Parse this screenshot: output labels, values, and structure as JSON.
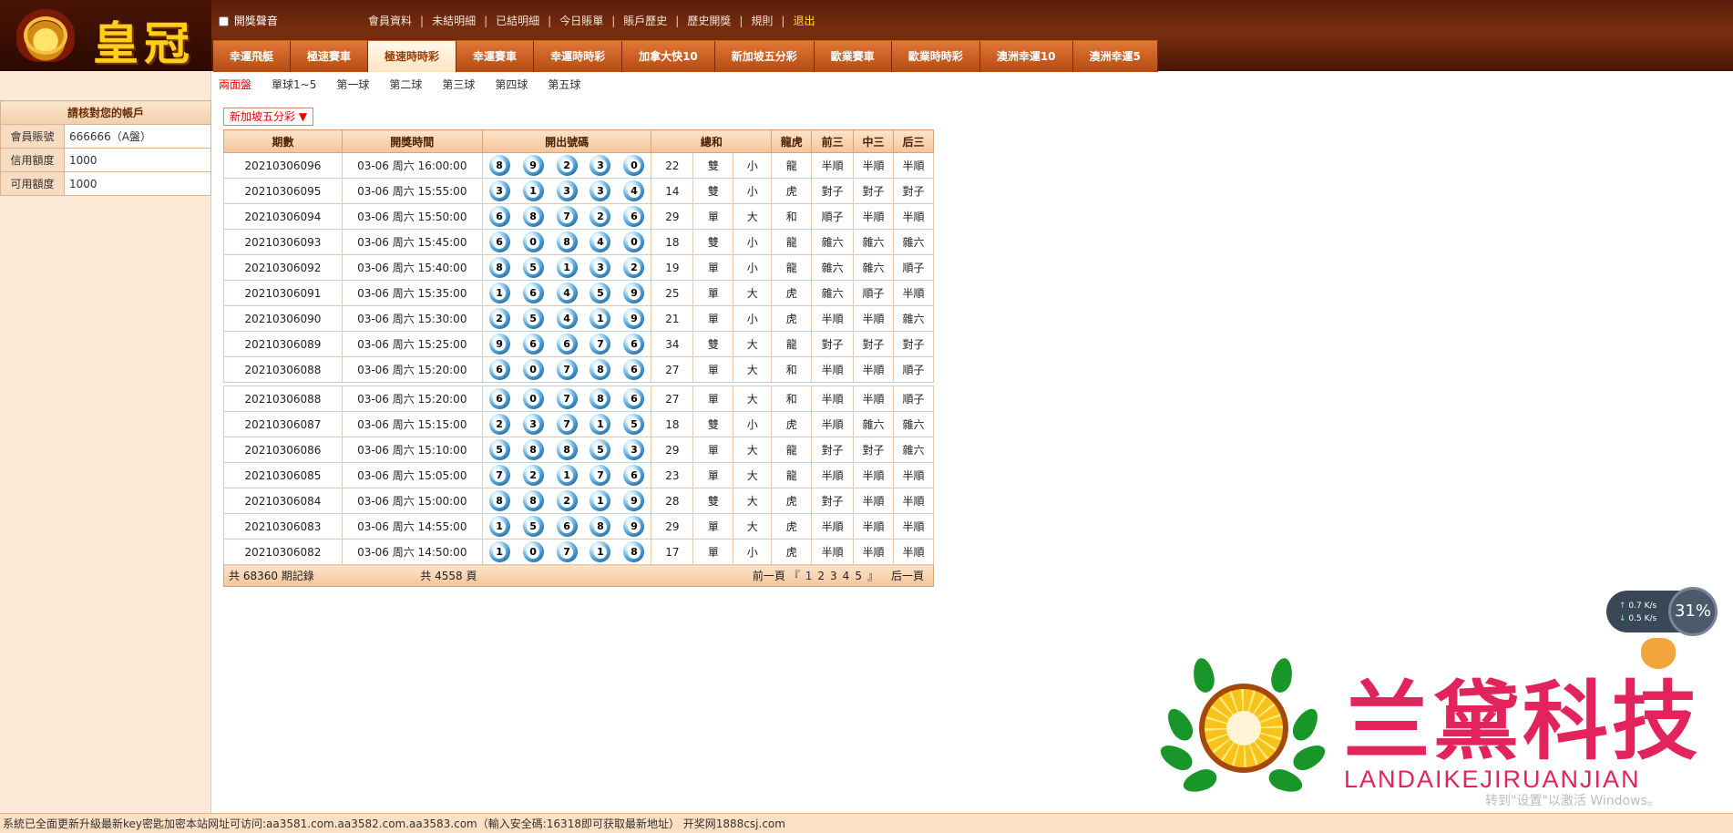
{
  "brand": {
    "name": "皇冠"
  },
  "header": {
    "sound_label": "開獎聲音",
    "links": [
      "會員資料",
      "未結明細",
      "已結明細",
      "今日賬單",
      "賬戶歷史",
      "歷史開獎",
      "規則"
    ],
    "logout": "退出"
  },
  "games": [
    "幸運飛艇",
    "極速賽車",
    "極速時時彩",
    "幸運賽車",
    "幸運時時彩",
    "加拿大快10",
    "新加坡五分彩",
    "歐業賽車",
    "歐業時時彩",
    "澳洲幸運10",
    "澳洲幸運5"
  ],
  "active_game_index": 2,
  "subtabs": [
    "兩面盤",
    "單球1~5",
    "第一球",
    "第二球",
    "第三球",
    "第四球",
    "第五球"
  ],
  "account": {
    "title": "請核對您的帳戶",
    "rows": [
      {
        "label": "會員賬號",
        "value": "666666（A盤）"
      },
      {
        "label": "信用額度",
        "value": "1000"
      },
      {
        "label": "可用額度",
        "value": "1000"
      }
    ]
  },
  "lottery_select": "新加坡五分彩",
  "table": {
    "headers": {
      "issue": "期數",
      "time": "開獎時間",
      "balls": "開出號碼",
      "sum": "總和",
      "dragon": "龍虎",
      "front": "前三",
      "mid": "中三",
      "back": "后三"
    },
    "rows": [
      {
        "issue": "20210306096",
        "date": "03-06",
        "weekday": "周六",
        "time": "16:00:00",
        "balls": [
          "8",
          "9",
          "2",
          "3",
          "0"
        ],
        "sum": "22",
        "oe": "雙",
        "bs": "小",
        "lh": "龍",
        "f": "半順",
        "m": "半順",
        "b": "半順"
      },
      {
        "issue": "20210306095",
        "date": "03-06",
        "weekday": "周六",
        "time": "15:55:00",
        "balls": [
          "3",
          "1",
          "3",
          "3",
          "4"
        ],
        "sum": "14",
        "oe": "雙",
        "bs": "小",
        "lh": "虎",
        "f": "對子",
        "m": "對子",
        "b": "對子"
      },
      {
        "issue": "20210306094",
        "date": "03-06",
        "weekday": "周六",
        "time": "15:50:00",
        "balls": [
          "6",
          "8",
          "7",
          "2",
          "6"
        ],
        "sum": "29",
        "oe": "單",
        "bs": "大",
        "lh": "和",
        "f": "順子",
        "m": "半順",
        "b": "半順"
      },
      {
        "issue": "20210306093",
        "date": "03-06",
        "weekday": "周六",
        "time": "15:45:00",
        "balls": [
          "6",
          "0",
          "8",
          "4",
          "0"
        ],
        "sum": "18",
        "oe": "雙",
        "bs": "小",
        "lh": "龍",
        "f": "雜六",
        "m": "雜六",
        "b": "雜六"
      },
      {
        "issue": "20210306092",
        "date": "03-06",
        "weekday": "周六",
        "time": "15:40:00",
        "balls": [
          "8",
          "5",
          "1",
          "3",
          "2"
        ],
        "sum": "19",
        "oe": "單",
        "bs": "小",
        "lh": "龍",
        "f": "雜六",
        "m": "雜六",
        "b": "順子"
      },
      {
        "issue": "20210306091",
        "date": "03-06",
        "weekday": "周六",
        "time": "15:35:00",
        "balls": [
          "1",
          "6",
          "4",
          "5",
          "9"
        ],
        "sum": "25",
        "oe": "單",
        "bs": "大",
        "lh": "虎",
        "f": "雜六",
        "m": "順子",
        "b": "半順"
      },
      {
        "issue": "20210306090",
        "date": "03-06",
        "weekday": "周六",
        "time": "15:30:00",
        "balls": [
          "2",
          "5",
          "4",
          "1",
          "9"
        ],
        "sum": "21",
        "oe": "單",
        "bs": "小",
        "lh": "虎",
        "f": "半順",
        "m": "半順",
        "b": "雜六"
      },
      {
        "issue": "20210306089",
        "date": "03-06",
        "weekday": "周六",
        "time": "15:25:00",
        "balls": [
          "9",
          "6",
          "6",
          "7",
          "6"
        ],
        "sum": "34",
        "oe": "雙",
        "bs": "大",
        "lh": "龍",
        "f": "對子",
        "m": "對子",
        "b": "對子"
      },
      {
        "issue": "20210306088",
        "date": "03-06",
        "weekday": "周六",
        "time": "15:20:00",
        "balls": [
          "6",
          "0",
          "7",
          "8",
          "6"
        ],
        "sum": "27",
        "oe": "單",
        "bs": "大",
        "lh": "和",
        "f": "半順",
        "m": "半順",
        "b": "順子"
      },
      {
        "issue": "20210306088",
        "date": "03-06",
        "weekday": "周六",
        "time": "15:20:00",
        "balls": [
          "6",
          "0",
          "7",
          "8",
          "6"
        ],
        "sum": "27",
        "oe": "單",
        "bs": "大",
        "lh": "和",
        "f": "半順",
        "m": "半順",
        "b": "順子"
      },
      {
        "issue": "20210306087",
        "date": "03-06",
        "weekday": "周六",
        "time": "15:15:00",
        "balls": [
          "2",
          "3",
          "7",
          "1",
          "5"
        ],
        "sum": "18",
        "oe": "雙",
        "bs": "小",
        "lh": "虎",
        "f": "半順",
        "m": "雜六",
        "b": "雜六"
      },
      {
        "issue": "20210306086",
        "date": "03-06",
        "weekday": "周六",
        "time": "15:10:00",
        "balls": [
          "5",
          "8",
          "8",
          "5",
          "3"
        ],
        "sum": "29",
        "oe": "單",
        "bs": "大",
        "lh": "龍",
        "f": "對子",
        "m": "對子",
        "b": "雜六"
      },
      {
        "issue": "20210306085",
        "date": "03-06",
        "weekday": "周六",
        "time": "15:05:00",
        "balls": [
          "7",
          "2",
          "1",
          "7",
          "6"
        ],
        "sum": "23",
        "oe": "單",
        "bs": "大",
        "lh": "龍",
        "f": "半順",
        "m": "半順",
        "b": "半順"
      },
      {
        "issue": "20210306084",
        "date": "03-06",
        "weekday": "周六",
        "time": "15:00:00",
        "balls": [
          "8",
          "8",
          "2",
          "1",
          "9"
        ],
        "sum": "28",
        "oe": "雙",
        "bs": "大",
        "lh": "虎",
        "f": "對子",
        "m": "半順",
        "b": "半順"
      },
      {
        "issue": "20210306083",
        "date": "03-06",
        "weekday": "周六",
        "time": "14:55:00",
        "balls": [
          "1",
          "5",
          "6",
          "8",
          "9"
        ],
        "sum": "29",
        "oe": "單",
        "bs": "大",
        "lh": "虎",
        "f": "半順",
        "m": "半順",
        "b": "半順"
      },
      {
        "issue": "20210306082",
        "date": "03-06",
        "weekday": "周六",
        "time": "14:50:00",
        "balls": [
          "1",
          "0",
          "7",
          "1",
          "8"
        ],
        "sum": "17",
        "oe": "單",
        "bs": "小",
        "lh": "虎",
        "f": "半順",
        "m": "半順",
        "b": "半順"
      }
    ],
    "footer": {
      "records": "共 68360 期記錄",
      "pages": "共 4558 頁",
      "prev": "前一頁",
      "page_numbers": [
        "1",
        "2",
        "3",
        "4",
        "5"
      ],
      "next": "后一頁"
    }
  },
  "speed_widget": {
    "up": "0.7",
    "down": "0.5",
    "unit": "K/s",
    "percent": "31"
  },
  "watermark": {
    "name": "兰黛科技",
    "sub": "LANDAIKEJIRUANJIAN",
    "windows": "转到\"设置\"以激活 Windows。"
  },
  "status_bar": "系統已全面更新升級最新key密匙加密本站网址可访问:aa3581.com.aa3582.com.aa3583.com（輸入安全碼:16318即可获取最新地址） 开奖网1888csj.com",
  "colors": {
    "red": "#e00000",
    "blue": "#1a24d8",
    "green": "#0a8a24",
    "header_dark": "#5a1c0a",
    "tab_orange": "#e07838",
    "panel_bg": "#fde9d8"
  }
}
